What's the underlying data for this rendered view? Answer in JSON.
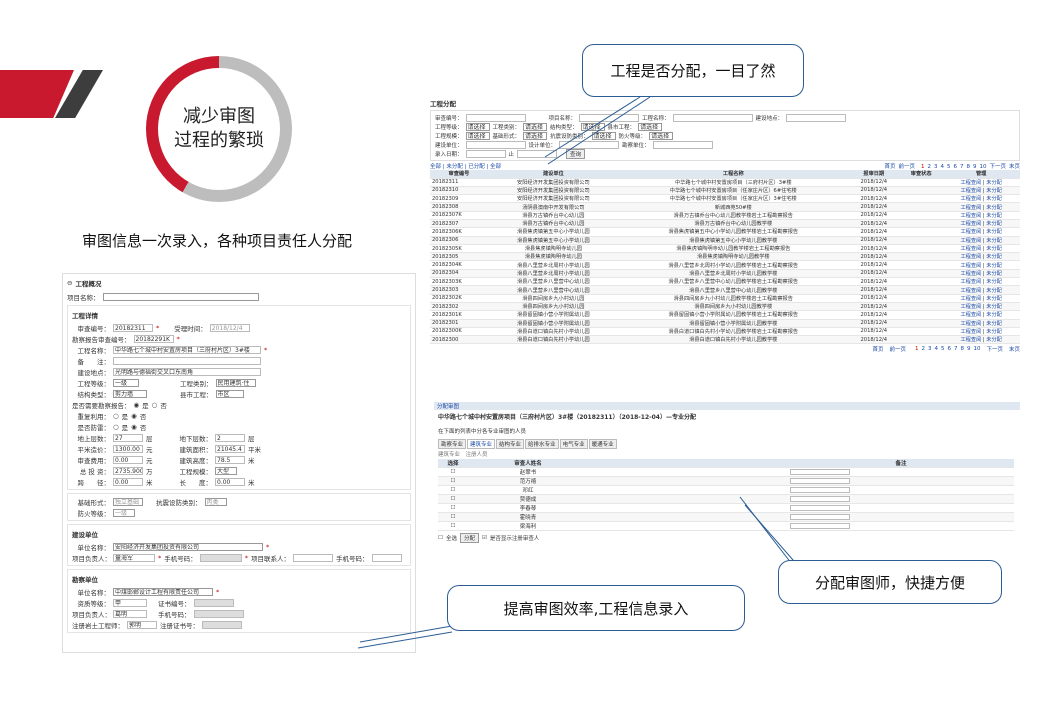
{
  "slide": {
    "ring_line1": "减少审图",
    "ring_line2": "过程的繁琐",
    "caption": "审图信息一次录入，各种项目责任人分配",
    "callout_top": "工程是否分配，一目了然",
    "callout_bottom_right": "分配审图师，快捷方便",
    "callout_bottom_left": "提高审图效率,工程信息录入",
    "accent": "#c8192e",
    "callout_border": "#2b5c93"
  },
  "form": {
    "section_title": "工程概况",
    "project_label": "项目名称：",
    "details_title": "工程详情",
    "review_no_label": "审查编号：",
    "review_no": "20182311",
    "accept_time_label": "受理时间：",
    "accept_time": "2018/12/4",
    "survey_no_label": "勘察报告审查编号：",
    "survey_no": "20182291K",
    "name_label": "工程名称：",
    "name": "中华路七个城中村安置房项目（三府村片区）3#楼",
    "remark_label": "备　　注：",
    "site_label": "建设地点：",
    "site": "光明路与德福街交叉口东南角",
    "grade_label": "工程等级：",
    "grade": "一级",
    "category_label": "工程类别：",
    "category": "民用建筑·住",
    "structure_label": "结构类型：",
    "structure": "剪力墙",
    "county_label": "县市工程：",
    "county": "市区",
    "needs_survey_label": "是否需要勘察报告：",
    "yes": "是",
    "no": "否",
    "repeat_label": "重复利用：",
    "single_label": "是否防雷：",
    "floors_above_label": "地上层数：",
    "floors_above": "27",
    "floors_below_label": "地下层数：",
    "floors_below": "2",
    "floor_unit": "层",
    "unit_price_label": "平米造价：",
    "unit_price": "1300.00",
    "price_unit": "元",
    "build_area_label": "建筑面积：",
    "build_area": "21045.4",
    "area_unit": "平米",
    "fee_label": "审查费用：",
    "fee": "0.00",
    "fee_unit": "元",
    "height_label": "建筑高度：",
    "height": "78.5",
    "height_unit": "米",
    "invest_label": "总 投 资：",
    "invest": "2735.9000",
    "invest_unit": "万",
    "scale_label": "工程规模：",
    "scale": "大型",
    "span_label": "跨　　径：",
    "span": "0.00",
    "span_unit": "米",
    "length_label": "长　　度：",
    "length": "0.00",
    "length_unit": "米",
    "foundation_label": "基础形式：",
    "foundation": "独立基础",
    "seismic_label": "抗震设防类别：",
    "seismic": "丙类",
    "fire_label": "防火等级：",
    "fire": "一级",
    "builder_title": "建设单位",
    "unit_name_label": "单位名称：",
    "builder_name": "安阳经济开发集团投资有限公司",
    "manager_label": "项目负责人：",
    "manager": "童海军",
    "phone_label": "手机号码：",
    "contact_label": "项目联系人：",
    "survey_title": "勘察单位",
    "survey_name": "中煤邯郸设计工程有限责任公司",
    "qual_grade_label": "资质等级：",
    "qual_grade": "甲",
    "cert_label": "证书编号：",
    "surveyor_label": "项目负责人：",
    "surveyor": "葛明",
    "survey_eng_label": "注册岩土工程师：",
    "survey_eng": "郭明",
    "reg_no_label": "注册证书号："
  },
  "list": {
    "title": "工程分配",
    "f_review_no": "审查编号：",
    "f_project": "项目名称：",
    "f_name": "工程名称：",
    "f_site": "建设地点：",
    "f_grade": "工程等级：",
    "f_category": "工程类别：",
    "f_structure": "结构类型：",
    "f_county": "县市工程：",
    "f_scale": "工程规模：",
    "f_foundation": "基础形式：",
    "f_seismic": "抗震设防类别：",
    "f_fire": "防火等级：",
    "f_builder": "建设单位：",
    "f_designer": "设计单位：",
    "f_surveyor": "勘察单位：",
    "f_entry": "录入日期：",
    "f_to": "止",
    "please_select": "请选择",
    "search_btn": "查询",
    "filter_tabs": "全部 | 未分配 | 已分配 | 全部",
    "pager_first": "首页",
    "pager_prev": "前一页",
    "pager_pages": [
      "1",
      "2",
      "3",
      "4",
      "5",
      "6",
      "7",
      "8",
      "9",
      "10"
    ],
    "pager_next": "下一页",
    "pager_last": "末页",
    "headers": [
      "审查编号",
      "建设单位",
      "工程名称",
      "报审日期",
      "审查状态",
      "管理"
    ],
    "op_detail": "工程查阅",
    "op_assign": "未分配",
    "rows": [
      {
        "no": "20182311",
        "builder": "安阳经济开发集团投资有限公司",
        "name": "中华路七个城中村安置房项目（三府村片区）3#楼",
        "date": "2018/12/4"
      },
      {
        "no": "20182310",
        "builder": "安阳经济开发集团投资有限公司",
        "name": "中华路七个城中村安置房项目（任家庄片区）6#住宅楼",
        "date": "2018/12/4"
      },
      {
        "no": "20182309",
        "builder": "安阳经济开发集团投资有限公司",
        "name": "中华路七个城中村安置房项目（任家庄片区）3#住宅楼",
        "date": "2018/12/4"
      },
      {
        "no": "20182308",
        "builder": "汤阴县澳南中开发有限公司",
        "name": "新城西苑50#楼",
        "date": "2018/12/4"
      },
      {
        "no": "20182307K",
        "builder": "滑县万古镇乔台中心幼儿园",
        "name": "滑县万古镇乔台中心幼儿园教学楼岩土工程勘察报告",
        "date": "2018/12/4"
      },
      {
        "no": "20182307",
        "builder": "滑县万古镇乔台中心幼儿园",
        "name": "滑县万古镇乔台中心幼儿园教学楼",
        "date": "2018/12/4"
      },
      {
        "no": "20182306K",
        "builder": "滑县焦虎镇第五中心小学幼儿园",
        "name": "滑县焦虎镇第五中心小学幼儿园教学楼岩土工程勘察报告",
        "date": "2018/12/4"
      },
      {
        "no": "20182306",
        "builder": "滑县焦虎镇第五中心小学幼儿园",
        "name": "滑县焦虎镇第五中心小学幼儿园教学楼",
        "date": "2018/12/4"
      },
      {
        "no": "20182305K",
        "builder": "滑县焦虎镇陶明寺幼儿园",
        "name": "滑县焦虎镇陶明寺幼儿园教学楼岩土工程勘察报告",
        "date": "2018/12/4"
      },
      {
        "no": "20182305",
        "builder": "滑县焦虎镇陶明寺幼儿园",
        "name": "滑县焦虎镇陶明寺幼儿园教学楼",
        "date": "2018/12/4"
      },
      {
        "no": "20182304K",
        "builder": "滑县八里营乡北周村小学幼儿园",
        "name": "滑县八里营乡北周村小学幼儿园教学楼岩土工程勘察报告",
        "date": "2018/12/4"
      },
      {
        "no": "20182304",
        "builder": "滑县八里营乡北周村小学幼儿园",
        "name": "滑县八里营乡北周村小学幼儿园教学楼",
        "date": "2018/12/4"
      },
      {
        "no": "20182303K",
        "builder": "滑县八里营乡八里营中心幼儿园",
        "name": "滑县八里营乡八里营中心幼儿园教学楼岩土工程勘察报告",
        "date": "2018/12/4"
      },
      {
        "no": "20182303",
        "builder": "滑县八里营乡八里营中心幼儿园",
        "name": "滑县八里营乡八里营中心幼儿园教学楼",
        "date": "2018/12/4"
      },
      {
        "no": "20182302K",
        "builder": "滑县四间房乡九小村幼儿园",
        "name": "滑县四间房乡九小村幼儿园教学楼岩土工程勘察报告",
        "date": "2018/12/4"
      },
      {
        "no": "20182302",
        "builder": "滑县四间房乡九小村幼儿园",
        "name": "滑县四间房乡九小村幼儿园教学楼",
        "date": "2018/12/4"
      },
      {
        "no": "20182301K",
        "builder": "滑县留固镇小营小学附属幼儿园",
        "name": "滑县留固镇小营小学附属幼儿园教学楼岩土工程勘察报告",
        "date": "2018/12/4"
      },
      {
        "no": "20182301",
        "builder": "滑县留固镇小营小学附属幼儿园",
        "name": "滑县留固镇小营小学附属幼儿园教学楼",
        "date": "2018/12/4"
      },
      {
        "no": "20182300K",
        "builder": "滑县白道口镇白先村小学幼儿园",
        "name": "滑县白道口镇白先村小学幼儿园教学楼岩土工程勘察报告",
        "date": "2018/12/4"
      },
      {
        "no": "20182300",
        "builder": "滑县白道口镇白先村小学幼儿园",
        "name": "滑县白道口镇白先村小学幼儿园教学楼",
        "date": "2018/12/4"
      }
    ]
  },
  "assign": {
    "section": "分配审图",
    "title": "中华路七个城中村安置房项目（三府村片区）3#楼（20182311）（2018-12-04）—专业分配",
    "hint": "在下面的列表中分各专业审图的人员",
    "tabs": [
      "勘察专业",
      "建筑专业",
      "结构专业",
      "给排水专业",
      "电气专业",
      "暖通专业"
    ],
    "sub_tabs": "建筑专业　注册人员",
    "col_select": "选择",
    "col_name": "审查人姓名",
    "col_remark": "备注",
    "people": [
      "赵翠书",
      "范万禧",
      "邓红",
      "贾德成",
      "李春琴",
      "霍晓青",
      "梁海利"
    ],
    "select_all": "全选",
    "assign_btn": "分配",
    "show_registered": "是否显示注册审查人"
  }
}
